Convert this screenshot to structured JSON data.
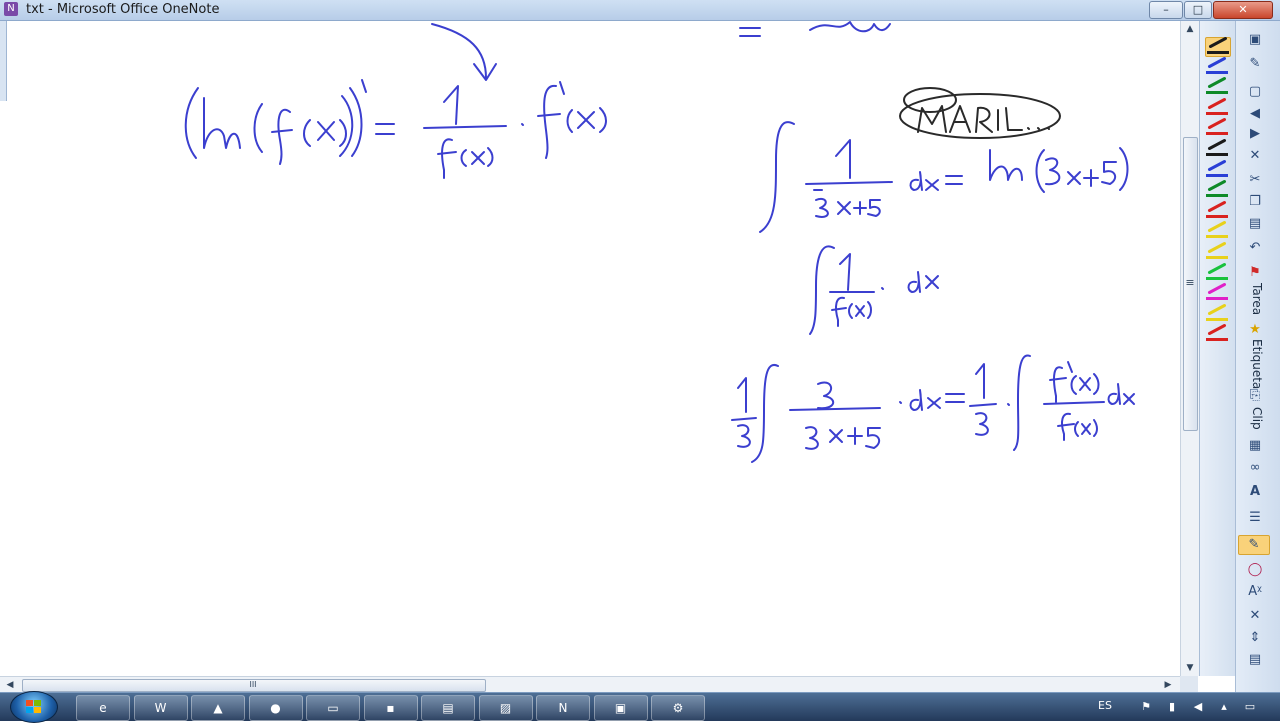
{
  "window": {
    "title": "txt - Microsoft Office OneNote"
  },
  "title_buttons": {
    "minimize": "–",
    "maximize": "□",
    "close": "✕"
  },
  "scrollbars": {
    "up": "▲",
    "down": "▼",
    "left": "◀",
    "right": "▶",
    "grip": "≡",
    "hgrip": "III"
  },
  "pens": [
    {
      "color": "#1a1a1a",
      "selected": true
    },
    {
      "color": "#2a3fd6"
    },
    {
      "color": "#0e8a28"
    },
    {
      "color": "#d9221f"
    },
    {
      "color": "#d9221f"
    },
    {
      "color": "#1a1a1a"
    },
    {
      "color": "#2a3fd6"
    },
    {
      "color": "#0e8a28"
    },
    {
      "color": "#d9221f"
    },
    {
      "color": "#e8d11b"
    },
    {
      "color": "#e8d11b"
    },
    {
      "color": "#19c23d"
    },
    {
      "color": "#e020c8"
    },
    {
      "color": "#e8d11b"
    },
    {
      "color": "#d9221f"
    }
  ],
  "side_tools": {
    "tarea_label": "Tarea",
    "etiqueta_label": "Etiqueta",
    "clip_label": "Clip"
  },
  "taskbar": {
    "apps": [
      {
        "name": "internet-explorer",
        "glyph": "e"
      },
      {
        "name": "word",
        "glyph": "W"
      },
      {
        "name": "photo-viewer",
        "glyph": "▲"
      },
      {
        "name": "firefox",
        "glyph": "●"
      },
      {
        "name": "explorer",
        "glyph": "▭"
      },
      {
        "name": "terminal",
        "glyph": "▪"
      },
      {
        "name": "notebook",
        "glyph": "▤"
      },
      {
        "name": "folder",
        "glyph": "▨"
      },
      {
        "name": "onenote",
        "glyph": "N"
      },
      {
        "name": "display",
        "glyph": "▣"
      },
      {
        "name": "tools",
        "glyph": "⚙"
      }
    ],
    "language": "ES"
  },
  "colors": {
    "ink_blue": "#3b3fcf",
    "ink_black": "#2a2a2a"
  }
}
